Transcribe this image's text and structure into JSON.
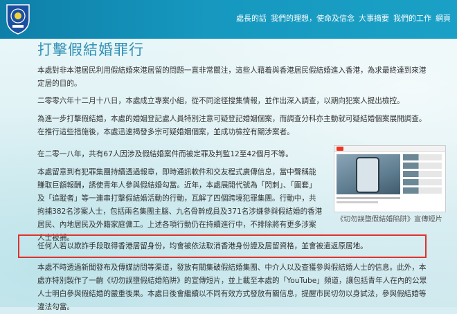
{
  "nav": {
    "items": [
      "處長的話",
      "我們的理想，使命及信念",
      "大事摘要",
      "我們的工作",
      "網頁"
    ]
  },
  "page": {
    "title": "打擊假結婚罪行",
    "paragraphs": [
      "本處對非本港居民利用假結婚來港居留的問題一直非常關注，這些人藉着與香港居民假結婚進入香港，為求最終達到來港定居的目的。",
      "二零零六年十二月十八日，本處成立專案小組，從不同途徑搜集情報，並作出深入調查，以期向犯案人提出檢控。",
      "為進一步打擊假結婚，本處的婚姻登記處人員特別注意可疑登記婚姻個案，而調查分科亦主動就可疑結婚個案展開調查。在推行這些措施後，本處迅速揭發多宗可疑婚姻個案，並成功檢控有關涉案者。",
      "在二零一八年，共有67人因涉及假結婚案件而被定罪及判監12至42個月不等。",
      "本處留意到有犯罪集團持續透過報章，即時通訊軟件和交友程式廣傳信息，當中聲稱能賺取巨額報酬，誘使青年人參與假結婚勾當。近年，本處展開代號為「閃刺」、「圍套」及「追蹤者」等一連串打擊假結婚活動的行動，瓦解了四個跨境犯罪集團。行動中，共拘捕382名涉案人士，包括兩名集團主腦、九名骨幹成員及371名涉嫌參與假結婚的香港居民、內地居民及外籍家庭傭工。上述各項行動仍在持續進行中，不排除將有更多涉案人士被捕。",
      "任何人若以欺詐手段取得香港居留身份，均會被依法取消香港身份證及居留資格，並會被遣返原居地。",
      "本處不時透過新聞發布及傳媒訪問等渠道，發放有關集破假結婚集團、中介人以及查獲參與假結婚人士的信息。此外，本處亦特別製作了一齣《切勿誤墮假結婚陷阱》的宣傳短片，並上載至本處的「YouTube」頻道，讓包括青年人在內的公眾人士明白參與假結婚的嚴重後果。本處日後會繼續以不同有效方式發放有關信息，提醒市民切勿以身試法，參與假結婚等違法勾當。"
    ],
    "video_caption": "《切勿誤墮假結婚陷阱》宣傳短片"
  },
  "colors": {
    "header": "#1698bf",
    "title": "#2e8fb4",
    "highlight_box": "#e0312b"
  }
}
